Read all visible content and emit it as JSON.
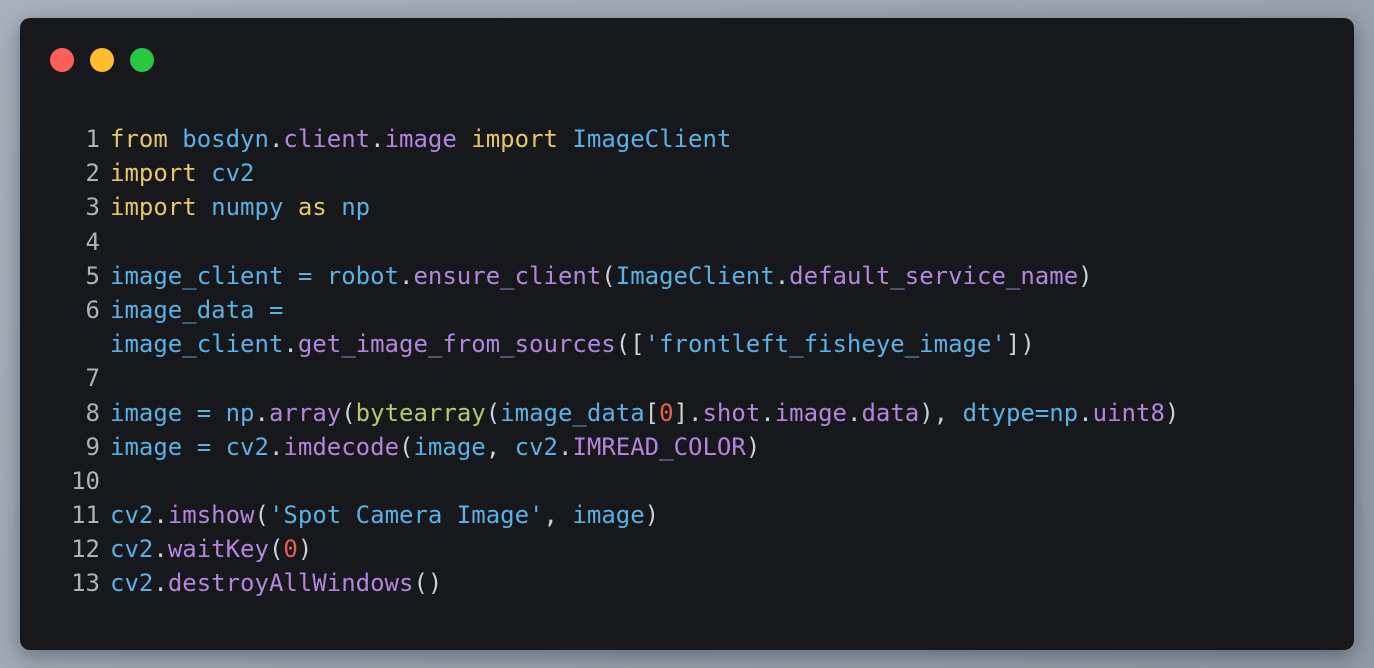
{
  "window": {
    "buttons": [
      {
        "name": "close",
        "color": "#ff5f57"
      },
      {
        "name": "minimize",
        "color": "#febc2e"
      },
      {
        "name": "zoom",
        "color": "#28c840"
      }
    ]
  },
  "code": {
    "lines": [
      {
        "n": "1",
        "tokens": [
          [
            "kw",
            "from"
          ],
          [
            "p",
            " "
          ],
          [
            "mod",
            "bosdyn"
          ],
          [
            "punc",
            "."
          ],
          [
            "attr",
            "client"
          ],
          [
            "punc",
            "."
          ],
          [
            "attr",
            "image"
          ],
          [
            "p",
            " "
          ],
          [
            "kw",
            "import"
          ],
          [
            "p",
            " "
          ],
          [
            "mod",
            "ImageClient"
          ]
        ]
      },
      {
        "n": "2",
        "tokens": [
          [
            "kw",
            "import"
          ],
          [
            "p",
            " "
          ],
          [
            "mod",
            "cv2"
          ]
        ]
      },
      {
        "n": "3",
        "tokens": [
          [
            "kw",
            "import"
          ],
          [
            "p",
            " "
          ],
          [
            "mod",
            "numpy"
          ],
          [
            "p",
            " "
          ],
          [
            "kw",
            "as"
          ],
          [
            "p",
            " "
          ],
          [
            "mod",
            "np"
          ]
        ]
      },
      {
        "n": "4",
        "tokens": []
      },
      {
        "n": "5",
        "tokens": [
          [
            "mod",
            "image_client"
          ],
          [
            "p",
            " "
          ],
          [
            "op",
            "="
          ],
          [
            "p",
            " "
          ],
          [
            "mod",
            "robot"
          ],
          [
            "punc",
            "."
          ],
          [
            "fn",
            "ensure_client"
          ],
          [
            "punc",
            "("
          ],
          [
            "mod",
            "ImageClient"
          ],
          [
            "punc",
            "."
          ],
          [
            "attr",
            "default_service_name"
          ],
          [
            "punc",
            ")"
          ]
        ]
      },
      {
        "n": "6",
        "tokens": [
          [
            "mod",
            "image_data"
          ],
          [
            "p",
            " "
          ],
          [
            "op",
            "="
          ]
        ]
      },
      {
        "n": "",
        "tokens": [
          [
            "mod",
            "image_client"
          ],
          [
            "punc",
            "."
          ],
          [
            "fn",
            "get_image_from_sources"
          ],
          [
            "punc",
            "(["
          ],
          [
            "str",
            "'frontleft_fisheye_image'"
          ],
          [
            "punc",
            "])"
          ]
        ]
      },
      {
        "n": "7",
        "tokens": []
      },
      {
        "n": "8",
        "tokens": [
          [
            "mod",
            "image"
          ],
          [
            "p",
            " "
          ],
          [
            "op",
            "="
          ],
          [
            "p",
            " "
          ],
          [
            "mod",
            "np"
          ],
          [
            "punc",
            "."
          ],
          [
            "fn",
            "array"
          ],
          [
            "punc",
            "("
          ],
          [
            "builtin",
            "bytearray"
          ],
          [
            "punc",
            "("
          ],
          [
            "mod",
            "image_data"
          ],
          [
            "punc",
            "["
          ],
          [
            "num",
            "0"
          ],
          [
            "punc",
            "]."
          ],
          [
            "attr",
            "shot"
          ],
          [
            "punc",
            "."
          ],
          [
            "attr",
            "image"
          ],
          [
            "punc",
            "."
          ],
          [
            "attr",
            "data"
          ],
          [
            "punc",
            "), "
          ],
          [
            "mod",
            "dtype"
          ],
          [
            "op",
            "="
          ],
          [
            "mod",
            "np"
          ],
          [
            "punc",
            "."
          ],
          [
            "attr",
            "uint8"
          ],
          [
            "punc",
            ")"
          ]
        ]
      },
      {
        "n": "9",
        "tokens": [
          [
            "mod",
            "image"
          ],
          [
            "p",
            " "
          ],
          [
            "op",
            "="
          ],
          [
            "p",
            " "
          ],
          [
            "mod",
            "cv2"
          ],
          [
            "punc",
            "."
          ],
          [
            "fn",
            "imdecode"
          ],
          [
            "punc",
            "("
          ],
          [
            "mod",
            "image"
          ],
          [
            "punc",
            ", "
          ],
          [
            "mod",
            "cv2"
          ],
          [
            "punc",
            "."
          ],
          [
            "attr",
            "IMREAD_COLOR"
          ],
          [
            "punc",
            ")"
          ]
        ]
      },
      {
        "n": "10",
        "tokens": []
      },
      {
        "n": "11",
        "tokens": [
          [
            "mod",
            "cv2"
          ],
          [
            "punc",
            "."
          ],
          [
            "fn",
            "imshow"
          ],
          [
            "punc",
            "("
          ],
          [
            "str",
            "'Spot Camera Image'"
          ],
          [
            "punc",
            ", "
          ],
          [
            "mod",
            "image"
          ],
          [
            "punc",
            ")"
          ]
        ]
      },
      {
        "n": "12",
        "tokens": [
          [
            "mod",
            "cv2"
          ],
          [
            "punc",
            "."
          ],
          [
            "fn",
            "waitKey"
          ],
          [
            "punc",
            "("
          ],
          [
            "num",
            "0"
          ],
          [
            "punc",
            ")"
          ]
        ]
      },
      {
        "n": "13",
        "tokens": [
          [
            "mod",
            "cv2"
          ],
          [
            "punc",
            "."
          ],
          [
            "fn",
            "destroyAllWindows"
          ],
          [
            "punc",
            "()"
          ]
        ]
      }
    ]
  }
}
